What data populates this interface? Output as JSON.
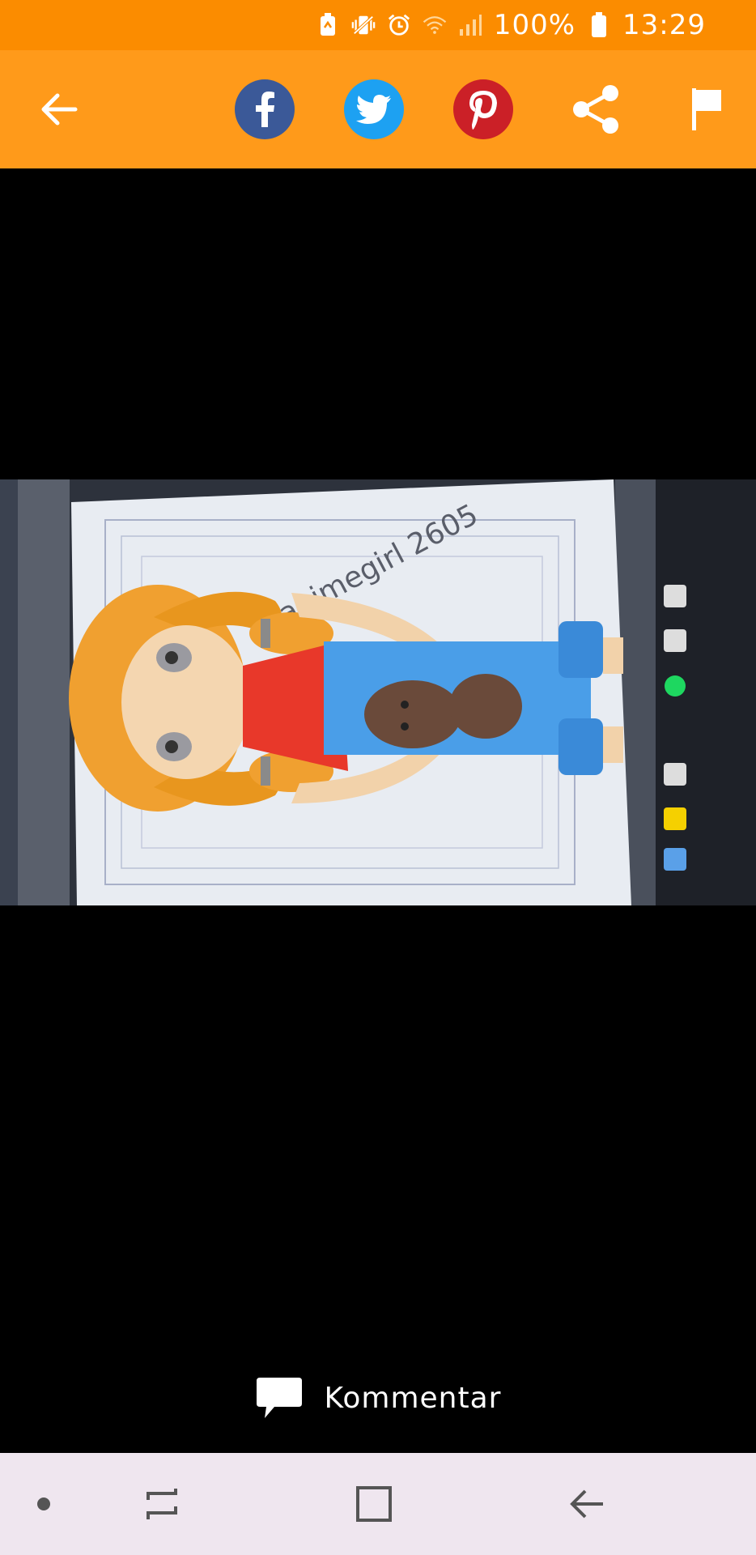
{
  "status_bar": {
    "battery_percent": "100%",
    "time": "13:29",
    "icons": [
      "battery-saver-icon",
      "vibrate-icon",
      "alarm-icon",
      "wifi-icon",
      "signal-icon",
      "battery-icon"
    ]
  },
  "app_bar": {
    "icons": [
      "back-arrow-icon",
      "facebook-icon",
      "twitter-icon",
      "pinterest-icon",
      "share-icon",
      "flag-icon"
    ]
  },
  "photo": {
    "signature": "animegirl 2605"
  },
  "comment": {
    "label": "Kommentar"
  },
  "nav_bar": {
    "icons": [
      "dot-icon",
      "recent-apps-icon",
      "home-icon",
      "back-icon"
    ]
  },
  "colors": {
    "status_bar": "#fb8c00",
    "app_bar": "#ff9a1a",
    "facebook": "#3b5998",
    "twitter": "#1da1f2",
    "pinterest": "#cb2027",
    "nav_bar": "#efe6ef"
  }
}
